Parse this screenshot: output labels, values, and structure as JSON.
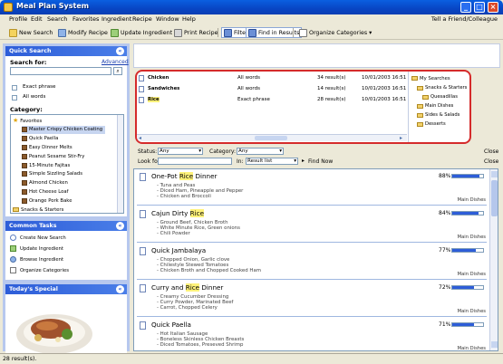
{
  "window": {
    "title": "Meal Plan System"
  },
  "menu": [
    "Profile",
    "Edit",
    "Search",
    "Favorites",
    "Ingredient",
    "Recipe",
    "Window",
    "Help"
  ],
  "menu_right": "Tell a Friend/Colleague",
  "toolbar": {
    "new_search": "New Search",
    "modify_recipe": "Modify Recipe",
    "update_ingredient": "Update Ingredient",
    "print_recipe": "Print Recipe",
    "filter": "Filter",
    "find_in_results": "Find in Results",
    "organize_categories": "Organize Categories"
  },
  "quick_search": {
    "header": "Quick Search",
    "search_for_label": "Search for:",
    "advanced_link": "Advanced",
    "search_value": "",
    "go_label": "⌕",
    "exact_phrase": "Exact phrase",
    "all_words": "All words",
    "category_label": "Category:",
    "tree": [
      {
        "label": "Favorites",
        "level": 0
      },
      {
        "label": "Master Crispy Chicken Coating",
        "level": 1,
        "selected": true
      },
      {
        "label": "Quick Paella",
        "level": 1
      },
      {
        "label": "Easy Dinner Melts",
        "level": 1
      },
      {
        "label": "Peanut Sesame Stir-Fry",
        "level": 1
      },
      {
        "label": "15-Minute Fajitas",
        "level": 1
      },
      {
        "label": "Simple Sizzling Salads",
        "level": 1
      },
      {
        "label": "Almond Chicken",
        "level": 1
      },
      {
        "label": "Hot Cheese Loaf",
        "level": 1
      },
      {
        "label": "Orange Pork Bake",
        "level": 1
      },
      {
        "label": "Snacks & Starters",
        "level": 0
      }
    ]
  },
  "common_tasks": {
    "header": "Common Tasks",
    "items": [
      "Create New Search",
      "Update Ingredient",
      "Browse Ingredient",
      "Organize Categories"
    ]
  },
  "special": {
    "header": "Today's Special"
  },
  "saved_searches": {
    "rows": [
      {
        "term": "Chicken",
        "mode": "All words",
        "count": "34 result(s)",
        "date": "10/01/2003 16:51"
      },
      {
        "term": "Sandwiches",
        "mode": "All words",
        "count": "14 result(s)",
        "date": "10/01/2003 16:51"
      },
      {
        "term": "Rice",
        "mode": "Exact phrase",
        "count": "28 result(s)",
        "date": "10/01/2003 16:51"
      }
    ],
    "tree_title": "My Searches",
    "tree": [
      "Snacks & Starters",
      "Quesadillas",
      "Main Dishes",
      "Sides & Salads",
      "Desserts"
    ]
  },
  "filters": {
    "status_label": "Status:",
    "status_value": "Any",
    "category_label": "Category:",
    "category_value": "Any",
    "look_for_label": "Look for:",
    "in_label": "In:",
    "in_value": "Result list",
    "find_now": "Find Now",
    "close": "Close"
  },
  "results": [
    {
      "pre": "One-Pot ",
      "hl": "Rice",
      "post": " Dinner",
      "pct": 88,
      "pct_label": "88%",
      "category": "Main Dishes",
      "ingredients": [
        "- Tuna and Peas",
        "- Diced Ham, Pineapple and Pepper",
        "- Chicken and Broccoli"
      ]
    },
    {
      "pre": "Cajun Dirty ",
      "hl": "Rice",
      "post": "",
      "pct": 84,
      "pct_label": "84%",
      "category": "Main Dishes",
      "ingredients": [
        "- Ground Beef, Chicken Broth",
        "- White Minute Rice, Green onions",
        "- Chili Powder"
      ]
    },
    {
      "pre": "Quick Jambalaya",
      "hl": "",
      "post": "",
      "pct": 77,
      "pct_label": "77%",
      "category": "Main Dishes",
      "ingredients": [
        "- Chopped Onion, Garlic clove",
        "- Chilestyle Stewed Tomatoes",
        "- Chicken Broth and Chopped Cooked Ham"
      ]
    },
    {
      "pre": "Curry and ",
      "hl": "Rice",
      "post": " Dinner",
      "pct": 72,
      "pct_label": "72%",
      "category": "Main Dishes",
      "ingredients": [
        "- Creamy Cucumber Dressing",
        "- Curry Powder, Marinated Beef",
        "- Carrot, Chopped Celery"
      ]
    },
    {
      "pre": "Quick Paella",
      "hl": "",
      "post": "",
      "pct": 71,
      "pct_label": "71%",
      "category": "Main Dishes",
      "ingredients": [
        "- Hot Italian Sausage",
        "- Boneless Skinless Chicken Breasts",
        "- Diced Tomatoes, Preseved Shrimp"
      ]
    }
  ],
  "status": "28 result(s)."
}
